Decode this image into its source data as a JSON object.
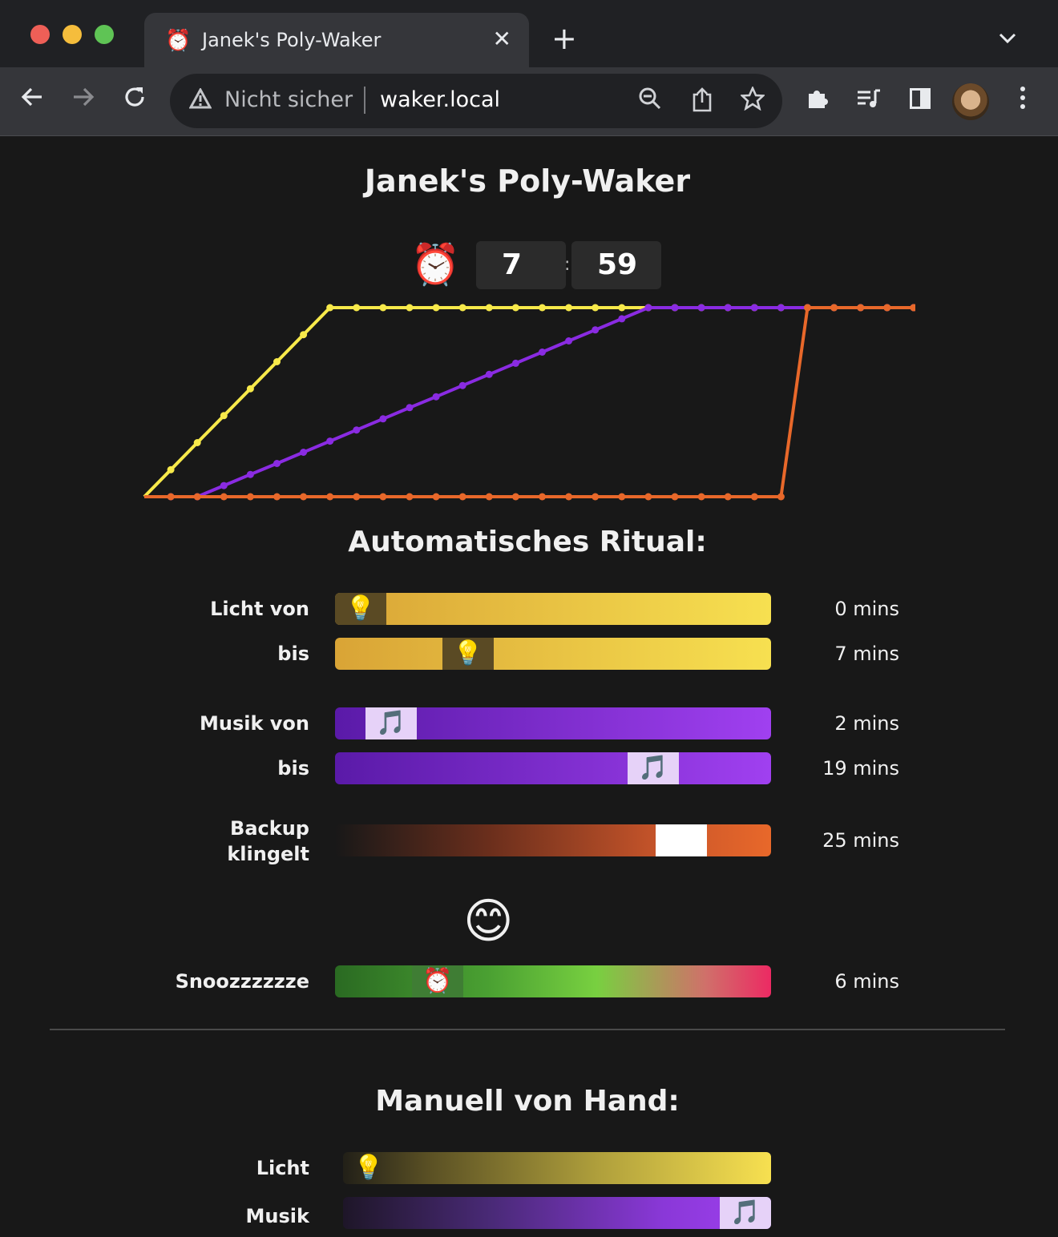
{
  "browser": {
    "tab_title": "Janek's Poly-Waker",
    "tab_icon": "⏰",
    "close_glyph": "✕",
    "newtab_glyph": "+",
    "security_text": "Nicht sicher",
    "url": "waker.local"
  },
  "page": {
    "title": "Janek's Poly-Waker",
    "alarm_emoji": "⏰",
    "alarm_hour": "7",
    "alarm_minute": "59",
    "colon": ":"
  },
  "chart_data": {
    "type": "line",
    "x": [
      0,
      1,
      2,
      3,
      4,
      5,
      6,
      7,
      8,
      9,
      10,
      11,
      12,
      13,
      14,
      15,
      16,
      17,
      18,
      19,
      20,
      21,
      22,
      23,
      24,
      25,
      26,
      27,
      28,
      29
    ],
    "ylim": [
      0,
      1
    ],
    "series": [
      {
        "color": "#f7e94a",
        "values": [
          0,
          0.143,
          0.286,
          0.429,
          0.571,
          0.714,
          0.857,
          1,
          1,
          1,
          1,
          1,
          1,
          1,
          1,
          1,
          1,
          1,
          1,
          1,
          1,
          1,
          1,
          1,
          1,
          1,
          1,
          1,
          1,
          1
        ]
      },
      {
        "color": "#8a2be2",
        "values": [
          0,
          0,
          0,
          0.059,
          0.118,
          0.176,
          0.235,
          0.294,
          0.353,
          0.412,
          0.471,
          0.529,
          0.588,
          0.647,
          0.706,
          0.765,
          0.824,
          0.882,
          0.941,
          1,
          1,
          1,
          1,
          1,
          1,
          1,
          1,
          1,
          1,
          1
        ]
      },
      {
        "color": "#e8682a",
        "values": [
          0,
          0,
          0,
          0,
          0,
          0,
          0,
          0,
          0,
          0,
          0,
          0,
          0,
          0,
          0,
          0,
          0,
          0,
          0,
          0,
          0,
          0,
          0,
          0,
          0,
          1,
          1,
          1,
          1,
          1
        ]
      }
    ]
  },
  "automatic": {
    "heading": "Automatisches Ritual:",
    "rows": [
      {
        "label": "Licht von",
        "value": "0 mins",
        "minutes": 0,
        "max": 25,
        "icon": "💡"
      },
      {
        "label": "bis",
        "value": "7 mins",
        "minutes": 7,
        "max": 25,
        "icon": "💡"
      },
      {
        "label": "Musik von",
        "value": "2 mins",
        "minutes": 2,
        "max": 25,
        "icon": "🎵"
      },
      {
        "label": "bis",
        "value": "19 mins",
        "minutes": 19,
        "max": 25,
        "icon": "🎵"
      },
      {
        "label": "Backup klingelt",
        "label_line1": "Backup",
        "label_line2": "klingelt",
        "value": "25 mins",
        "minutes": 25,
        "max": 30,
        "icon": ""
      }
    ],
    "mood_emoji": "😊",
    "snooze": {
      "label": "Snoozzzzzze",
      "value": "6 mins",
      "minutes": 6,
      "max": 30,
      "icon": "⏰"
    }
  },
  "manual": {
    "heading": "Manuell von Hand:",
    "rows": [
      {
        "label": "Licht",
        "level": 0,
        "icon": "💡"
      },
      {
        "label": "Musik",
        "level": 1,
        "icon": "🎵"
      }
    ]
  },
  "colors": {
    "light": "#f7e94a",
    "music": "#8a2be2",
    "backup": "#e8682a",
    "snooze_green": "#6fd43f",
    "snooze_red": "#ec2a63"
  }
}
